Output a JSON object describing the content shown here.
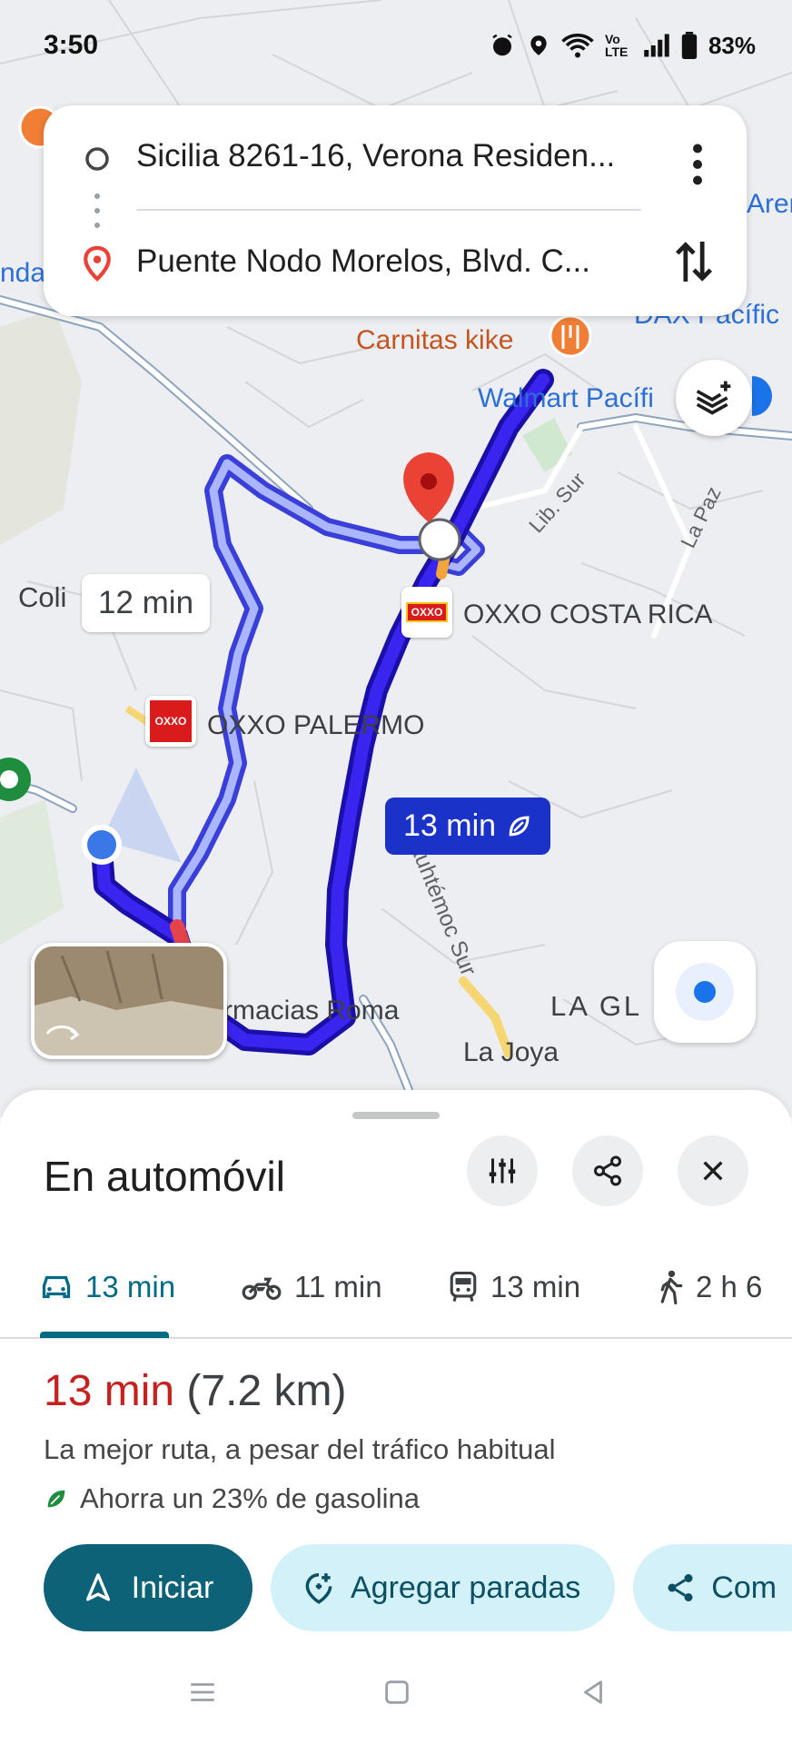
{
  "status": {
    "time": "3:50",
    "battery": "83%",
    "network_label": "Vo LTE"
  },
  "search": {
    "origin": "Sicilia 8261-16, Verona Residen...",
    "destination": "Puente Nodo Morelos, Blvd. C..."
  },
  "map": {
    "labels": {
      "carnitas": "Carnitas kike",
      "walmart": "Walmart Pacífi",
      "dax": "DAX Pacífic",
      "aren": "Aren",
      "ndad": "ndad",
      "lib_sur": "Lib. Sur",
      "la_paz": "La Paz",
      "oxxo_costa_rica": "OXXO COSTA RICA",
      "oxxo_palermo": "OXXO PALERMO",
      "coli": "Coli",
      "cuauhtemoc": "uauhtémoc Sur",
      "farmacias": "rmacias Roma",
      "la_gl": "LA GL",
      "la_joya": "La Joya",
      "oxxo_logo": "OXXO"
    },
    "alt_route_time": "12 min",
    "main_route_time": "13 min"
  },
  "sheet": {
    "title": "En automóvil",
    "tabs": [
      {
        "label": "13 min",
        "mode": "car-icon"
      },
      {
        "label": "11 min",
        "mode": "motorcycle-icon"
      },
      {
        "label": "13 min",
        "mode": "transit-icon"
      },
      {
        "label": "2 h 6",
        "mode": "walk-icon"
      }
    ],
    "duration": "13 min",
    "distance": "(7.2 km)",
    "description": "La mejor ruta, a pesar del tráfico habitual",
    "eco": "Ahorra un 23% de gasolina",
    "actions": {
      "start": "Iniciar",
      "add_stops": "Agregar paradas",
      "share": "Com"
    }
  },
  "colors": {
    "route_main": "#2a17d8",
    "route_alt": "#aab6ff",
    "accent": "#0d6277",
    "destination_pin": "#ea4335"
  }
}
